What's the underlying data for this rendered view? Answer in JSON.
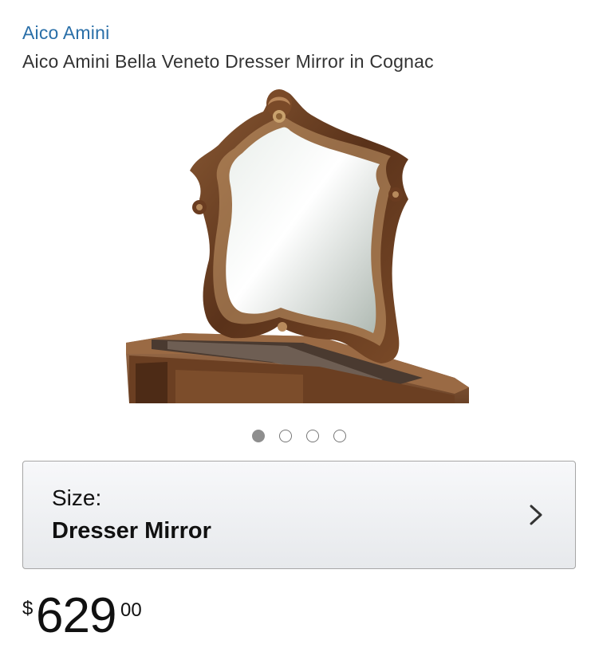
{
  "product": {
    "brand": "Aico Amini",
    "title": "Aico Amini Bella Veneto Dresser Mirror in Cognac"
  },
  "gallery": {
    "image": "ornate carved wood dresser mirror on dresser",
    "pages": 4,
    "active_page": 1
  },
  "size_selector": {
    "label": "Size:",
    "value": "Dresser Mirror",
    "icon": "chevron-right-icon"
  },
  "price": {
    "currency_symbol": "$",
    "whole": "629",
    "fraction": "00"
  },
  "colors": {
    "brand_link": "#2a6fa8",
    "wood_dark": "#5a321a",
    "wood_light": "#8a5a34",
    "mirror_glass": "#c9d2cd"
  }
}
